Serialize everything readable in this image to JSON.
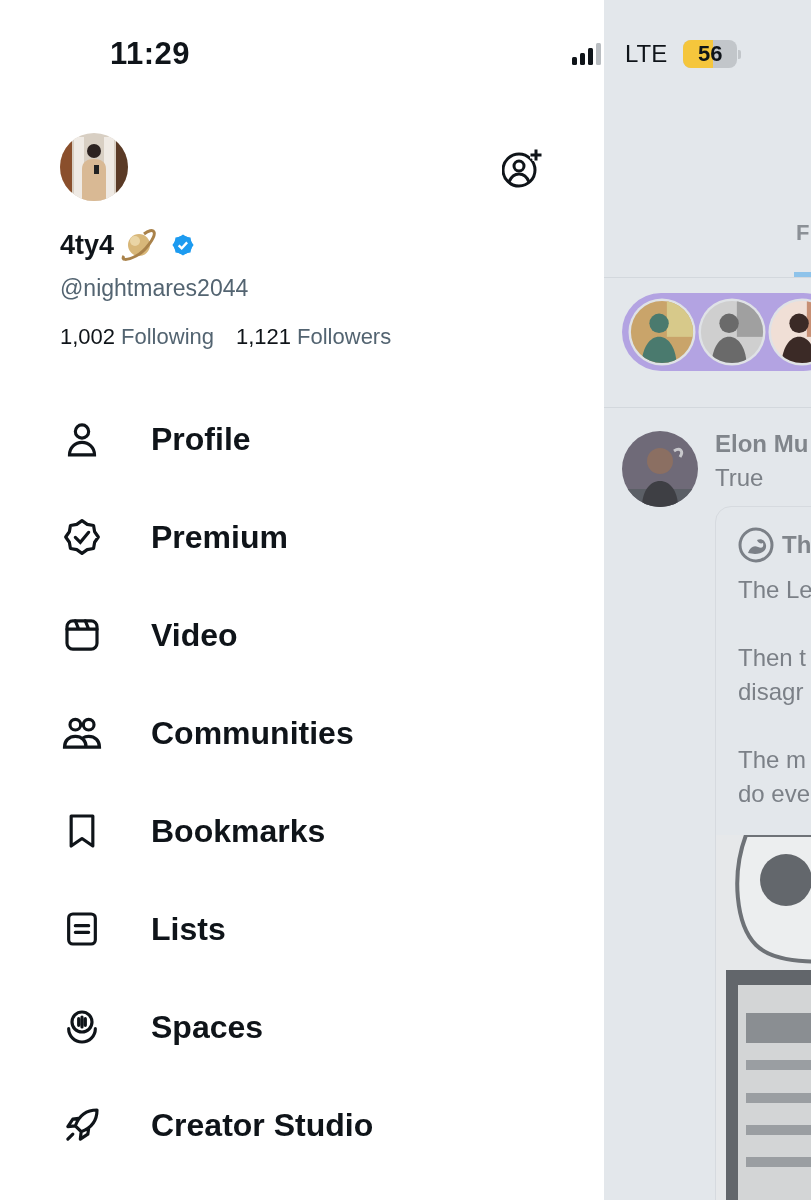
{
  "status_bar": {
    "time": "11:29",
    "network": "LTE",
    "battery": "56"
  },
  "drawer": {
    "name": "4ty4",
    "verified": true,
    "handle": "@nightmares2044",
    "stats": [
      {
        "count": "1,002",
        "label": "Following"
      },
      {
        "count": "1,121",
        "label": "Followers"
      }
    ],
    "menu": [
      {
        "label": "Profile",
        "kind": "profile"
      },
      {
        "label": "Premium",
        "kind": "premium"
      },
      {
        "label": "Video",
        "kind": "video"
      },
      {
        "label": "Communities",
        "kind": "communities"
      },
      {
        "label": "Bookmarks",
        "kind": "bookmarks"
      },
      {
        "label": "Lists",
        "kind": "lists"
      },
      {
        "label": "Spaces",
        "kind": "spaces"
      },
      {
        "label": "Creator Studio",
        "kind": "creator"
      }
    ]
  },
  "feed": {
    "tabs": [
      {
        "label": "F",
        "selected": true
      }
    ],
    "post": {
      "author": "Elon Mu",
      "text": "True",
      "quote": {
        "author": "Th",
        "paragraphs": [
          [
            "The Le"
          ],
          [
            "Then t",
            "disagr"
          ],
          [
            "The m",
            "do eve"
          ]
        ]
      }
    }
  }
}
